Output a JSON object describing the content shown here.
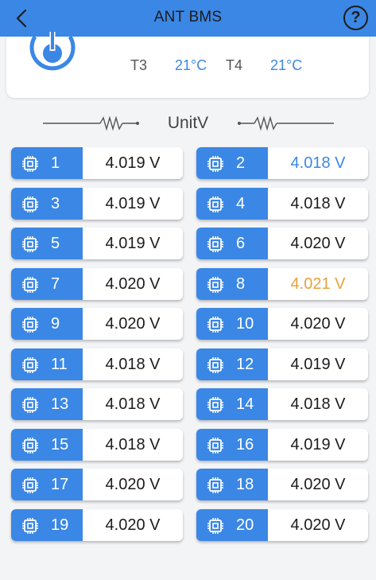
{
  "header": {
    "title": "ANT BMS",
    "help_label": "?"
  },
  "temps": {
    "t3_label": "T3",
    "t3_value": "21°C",
    "t4_label": "T4",
    "t4_value": "21°C"
  },
  "section_title": "UnitV",
  "colors": {
    "accent": "#3b87e5",
    "max": "#e3a33a",
    "min": "#3b87e5",
    "normal": "#1c1c1c"
  },
  "cells": [
    {
      "num": "1",
      "value": "4.019 V",
      "status": "normal"
    },
    {
      "num": "2",
      "value": "4.018 V",
      "status": "min"
    },
    {
      "num": "3",
      "value": "4.019 V",
      "status": "normal"
    },
    {
      "num": "4",
      "value": "4.018 V",
      "status": "normal"
    },
    {
      "num": "5",
      "value": "4.019 V",
      "status": "normal"
    },
    {
      "num": "6",
      "value": "4.020 V",
      "status": "normal"
    },
    {
      "num": "7",
      "value": "4.020 V",
      "status": "normal"
    },
    {
      "num": "8",
      "value": "4.021 V",
      "status": "max"
    },
    {
      "num": "9",
      "value": "4.020 V",
      "status": "normal"
    },
    {
      "num": "10",
      "value": "4.020 V",
      "status": "normal"
    },
    {
      "num": "11",
      "value": "4.018 V",
      "status": "normal"
    },
    {
      "num": "12",
      "value": "4.019 V",
      "status": "normal"
    },
    {
      "num": "13",
      "value": "4.018 V",
      "status": "normal"
    },
    {
      "num": "14",
      "value": "4.018 V",
      "status": "normal"
    },
    {
      "num": "15",
      "value": "4.018 V",
      "status": "normal"
    },
    {
      "num": "16",
      "value": "4.019 V",
      "status": "normal"
    },
    {
      "num": "17",
      "value": "4.020 V",
      "status": "normal"
    },
    {
      "num": "18",
      "value": "4.020 V",
      "status": "normal"
    },
    {
      "num": "19",
      "value": "4.020 V",
      "status": "normal"
    },
    {
      "num": "20",
      "value": "4.020 V",
      "status": "normal"
    }
  ]
}
